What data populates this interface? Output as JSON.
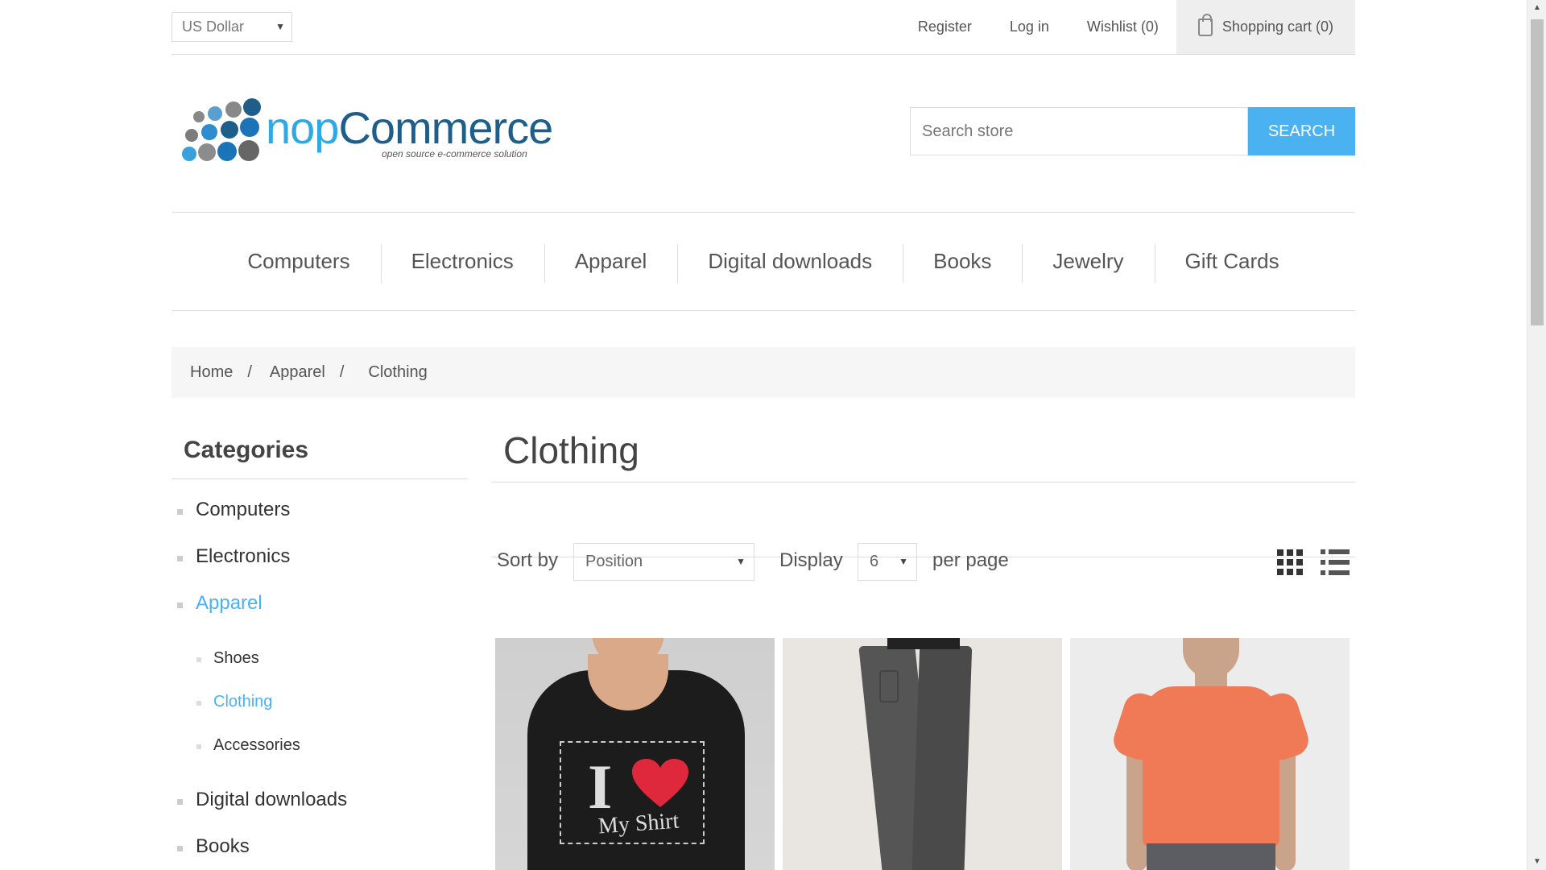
{
  "header_links": {
    "currency": "US Dollar",
    "register": "Register",
    "login": "Log in",
    "wishlist": "Wishlist (0)",
    "cart": "Shopping cart (0)"
  },
  "logo": {
    "brand_nop": "nop",
    "brand_commerce": "Commerce",
    "tagline": "open source e-commerce solution"
  },
  "search": {
    "placeholder": "Search store",
    "button": "SEARCH"
  },
  "nav": [
    "Computers",
    "Electronics",
    "Apparel",
    "Digital downloads",
    "Books",
    "Jewelry",
    "Gift Cards"
  ],
  "breadcrumb": {
    "home": "Home",
    "sep": "/",
    "apparel": "Apparel",
    "current": "Clothing"
  },
  "sidebar": {
    "title": "Categories",
    "categories": [
      "Computers",
      "Electronics",
      "Apparel",
      "Digital downloads",
      "Books"
    ],
    "subcategories": [
      "Shoes",
      "Clothing",
      "Accessories"
    ]
  },
  "main": {
    "title": "Clothing",
    "sort_label": "Sort by",
    "sort_value": "Position",
    "display_label": "Display",
    "display_value": "6",
    "per_page_label": "per page"
  },
  "products": [
    {
      "image": "graphic-tshirt"
    },
    {
      "image": "grey-trousers"
    },
    {
      "image": "orange-tshirt"
    }
  ],
  "colors": {
    "accent": "#4ab2f1",
    "brand_dark": "#1e5e8a"
  }
}
